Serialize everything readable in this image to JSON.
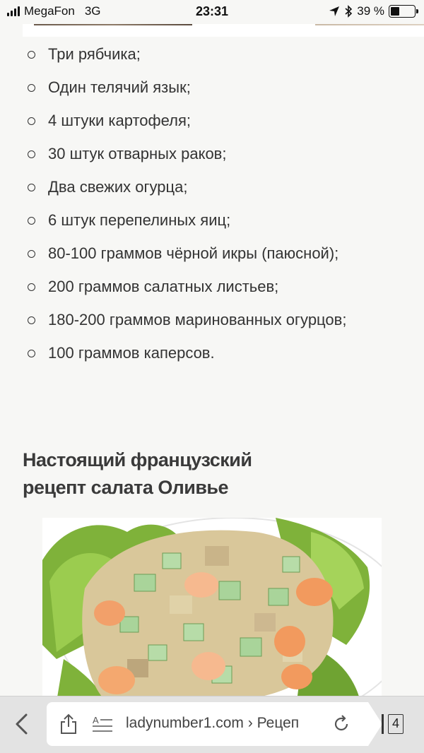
{
  "status_bar": {
    "carrier": "MegaFon",
    "network": "3G",
    "time": "23:31",
    "battery": "39 %",
    "battery_level": 0.39
  },
  "ingredients": [
    "Три рябчика;",
    "Один телячий язык;",
    "4 штуки картофеля;",
    "30 штук отварных раков;",
    "Два свежих огурца;",
    "6 штук перепелиных яиц;",
    "80-100 граммов чёрной икры (паюсной);",
    "200 граммов салатных листьев;",
    "180-200 граммов маринованных огурцов;",
    "100 граммов каперсов."
  ],
  "heading": "Настоящий французский рецепт салата Оливье",
  "browser": {
    "url": "ladynumber1.com › Рецеп",
    "tab_count": "4"
  },
  "icons": {
    "back": "chevron-left-icon",
    "share": "share-icon",
    "reader": "reader-text-icon",
    "reload": "reload-icon",
    "tabs": "tabs-icon",
    "location": "location-arrow-icon",
    "bluetooth": "bluetooth-icon"
  },
  "colors": {
    "page_bg": "#f7f7f5",
    "text": "#333333",
    "heading": "#3a3a3a",
    "toolbar_bg": "#e3e3e3"
  }
}
